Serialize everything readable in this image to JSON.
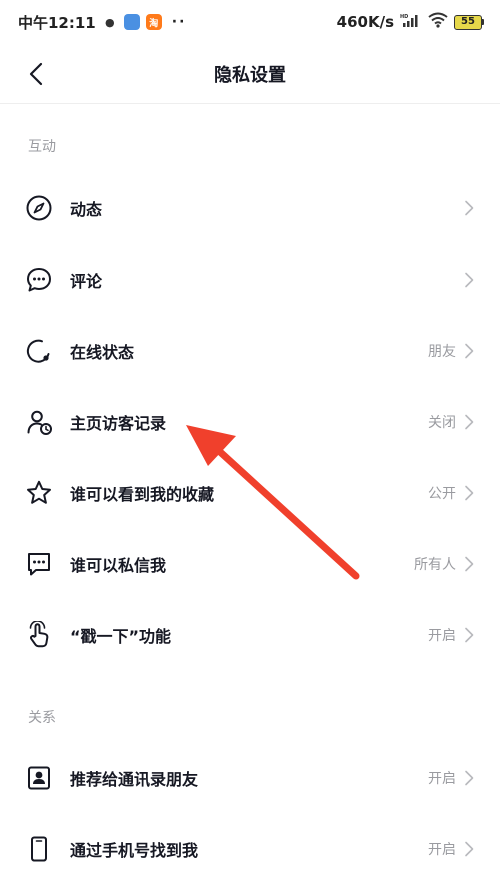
{
  "status_bar": {
    "time": "中午12:11",
    "network_speed": "460K/s",
    "network_type": "HD",
    "battery": "55",
    "app_icons": [
      {
        "name": "qq-icon",
        "color": "#ffffff",
        "glyph": "🐧"
      },
      {
        "name": "app-blue-icon",
        "color": "#4a90e2",
        "glyph": ""
      },
      {
        "name": "taobao-icon",
        "color": "#ff7a1a",
        "glyph": "淘"
      }
    ],
    "more": "··"
  },
  "nav": {
    "title": "隐私设置"
  },
  "sections": [
    {
      "label": "互动",
      "items": [
        {
          "icon": "compass-icon",
          "label": "动态",
          "value": ""
        },
        {
          "icon": "comment-icon",
          "label": "评论",
          "value": ""
        },
        {
          "icon": "online-status-icon",
          "label": "在线状态",
          "value": "朋友"
        },
        {
          "icon": "visitor-record-icon",
          "label": "主页访客记录",
          "value": "关闭"
        },
        {
          "icon": "star-icon",
          "label": "谁可以看到我的收藏",
          "value": "公开"
        },
        {
          "icon": "message-icon",
          "label": "谁可以私信我",
          "value": "所有人"
        },
        {
          "icon": "poke-hand-icon",
          "label": "“戳一下”功能",
          "value": "开启"
        }
      ]
    },
    {
      "label": "关系",
      "items": [
        {
          "icon": "contacts-icon",
          "label": "推荐给通讯录朋友",
          "value": "开启"
        },
        {
          "icon": "phone-icon",
          "label": "通过手机号找到我",
          "value": "开启"
        }
      ]
    }
  ],
  "annotation": {
    "arrow_color": "#f0402c"
  }
}
